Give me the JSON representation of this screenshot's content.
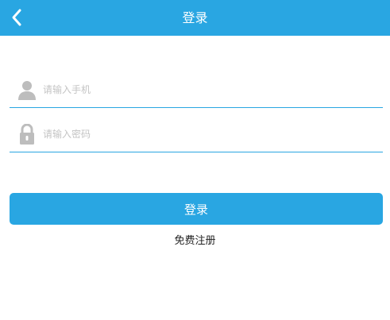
{
  "header": {
    "title": "登录",
    "back_icon": "chevron-left-icon"
  },
  "form": {
    "phone": {
      "placeholder": "请输入手机",
      "value": "",
      "icon": "user-icon"
    },
    "password": {
      "placeholder": "请输入密码",
      "value": "",
      "icon": "lock-icon"
    },
    "login_label": "登录",
    "register_label": "免费注册"
  },
  "colors": {
    "accent": "#29a6e2",
    "icon": "#bdbdbd",
    "placeholder": "#c4c4c4"
  }
}
